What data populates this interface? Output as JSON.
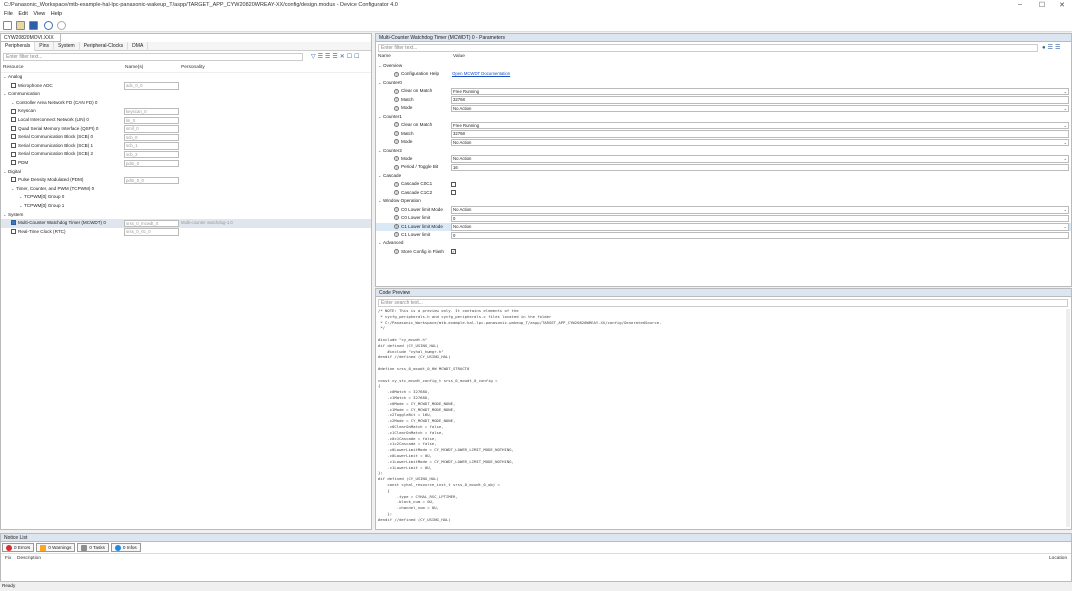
{
  "window": {
    "title": "C:/Panasonic_Workspace/mtb-example-hal-lpc-panasonic-wakeup_T/aspp/TARGET_APP_CYW20820WREAY-XX/config/design.modus - Device Configurator 4.0",
    "controls": [
      "–",
      "☐",
      "✕"
    ]
  },
  "menu": [
    "File",
    "Edit",
    "View",
    "Help"
  ],
  "left_panel": {
    "header": "CYW20820MOVI.XXX",
    "tabs": [
      "Peripherals",
      "Pins",
      "System",
      "Peripheral-Clocks",
      "DMA"
    ],
    "filter_placeholder": "Enter filter text...",
    "columns": [
      "Resource",
      "Name(s)",
      "Personality"
    ],
    "rows": [
      {
        "indent": 0,
        "type": "group",
        "label": "Analog"
      },
      {
        "indent": 1,
        "type": "item",
        "label": "Microphone ADC",
        "name": "adc_0_0",
        "checked": false
      },
      {
        "indent": 0,
        "type": "group",
        "label": "Communication"
      },
      {
        "indent": 1,
        "type": "group",
        "label": "Controller Area Network FD (CAN FD) 0"
      },
      {
        "indent": 1,
        "type": "item",
        "label": "Keyscan",
        "name": "keyscan_0",
        "checked": false
      },
      {
        "indent": 1,
        "type": "item",
        "label": "Local Interconnect Network (LIN) 0",
        "name": "lin_0",
        "checked": false
      },
      {
        "indent": 1,
        "type": "item",
        "label": "Quad Serial Memory Interface (QSPI) 0",
        "name": "smif_0",
        "checked": false
      },
      {
        "indent": 1,
        "type": "item",
        "label": "Serial Communication Block (SCB) 0",
        "name": "scb_0",
        "checked": false
      },
      {
        "indent": 1,
        "type": "item",
        "label": "Serial Communication Block (SCB) 1",
        "name": "scb_1",
        "checked": false
      },
      {
        "indent": 1,
        "type": "item",
        "label": "Serial Communication Block (SCB) 2",
        "name": "scb_2",
        "checked": false
      },
      {
        "indent": 1,
        "type": "item",
        "label": "PDM",
        "name": "pdm_0",
        "checked": false
      },
      {
        "indent": 0,
        "type": "group",
        "label": "Digital"
      },
      {
        "indent": 1,
        "type": "item",
        "label": "Pulse Density Modulated (PDM)",
        "name": "pdm_0_0",
        "checked": false
      },
      {
        "indent": 1,
        "type": "group",
        "label": "Timer, Counter, and PWM (TCPWM) 0"
      },
      {
        "indent": 2,
        "type": "group",
        "label": "TCPWM[0] Group 0"
      },
      {
        "indent": 2,
        "type": "group",
        "label": "TCPWM[0] Group 1"
      },
      {
        "indent": 0,
        "type": "group",
        "label": "System"
      },
      {
        "indent": 1,
        "type": "item",
        "label": "Multi-Counter Watchdog Timer (MCWDT) 0",
        "name": "srss_0_mcwdt_0",
        "personality": "Multi-counter watchdog-1.0",
        "checked": true,
        "selected": true
      },
      {
        "indent": 1,
        "type": "item",
        "label": "Real-Time Clock (RTC)",
        "name": "srss_0_rtc_0",
        "checked": false
      }
    ]
  },
  "params_panel": {
    "header": "Multi-Counter Watchdog Timer (MCWDT) 0 - Parameters",
    "filter_placeholder": "Enter filter text...",
    "columns": [
      "Name",
      "Value"
    ],
    "rows": [
      {
        "kind": "section",
        "label": "Overview"
      },
      {
        "kind": "param",
        "label": "Configuration Help",
        "value": "Open MCWDT Documentation",
        "link": true
      },
      {
        "kind": "section",
        "label": "Counter0"
      },
      {
        "kind": "param",
        "label": "Clear on Match",
        "value": "Free Running",
        "dropdown": true
      },
      {
        "kind": "param",
        "label": "Match",
        "value": "32768"
      },
      {
        "kind": "param",
        "label": "Mode",
        "value": "No Action",
        "dropdown": true
      },
      {
        "kind": "section",
        "label": "Counter1"
      },
      {
        "kind": "param",
        "label": "Clear on Match",
        "value": "Free Running",
        "dropdown": true
      },
      {
        "kind": "param",
        "label": "Match",
        "value": "32768"
      },
      {
        "kind": "param",
        "label": "Mode",
        "value": "No Action",
        "dropdown": true
      },
      {
        "kind": "section",
        "label": "Counter2"
      },
      {
        "kind": "param",
        "label": "Mode",
        "value": "No Action",
        "dropdown": true
      },
      {
        "kind": "param",
        "label": "Period / Toggle Bit",
        "value": "16"
      },
      {
        "kind": "section",
        "label": "Cascade"
      },
      {
        "kind": "param",
        "label": "Cascade C0C1",
        "checkbox": true
      },
      {
        "kind": "param",
        "label": "Cascade C1C2",
        "checkbox": true
      },
      {
        "kind": "section",
        "label": "Window Operation"
      },
      {
        "kind": "param",
        "label": "C0 Lower limit Mode",
        "value": "No Action",
        "dropdown": true
      },
      {
        "kind": "param",
        "label": "C0 Lower limit",
        "value": "0"
      },
      {
        "kind": "param",
        "label": "C1 Lower limit Mode",
        "value": "No Action",
        "dropdown": true,
        "highlight": true
      },
      {
        "kind": "param",
        "label": "C1 Lower limit",
        "value": "0"
      },
      {
        "kind": "section",
        "label": "Advanced"
      },
      {
        "kind": "param",
        "label": "Store Config in Flash",
        "checkbox": true,
        "checked": true
      }
    ]
  },
  "code_panel": {
    "header": "Code Preview",
    "filter_placeholder": "Enter search text...",
    "lines": [
      "/* NOTE: This is a preview only. It contains elements of the",
      " * cycfg_peripherals.h and cycfg_peripherals.c files located in the folder",
      " * C:/Panasonic_Workspace/mtb-example-hal-lpc-panasonic-wakeup_T/aspp/TARGET_APP_CYW20820WREAY-XX/config/GeneratedSource.",
      " */",
      "",
      "#include \"cy_mcwdt.h\"",
      "#if defined (CY_USING_HAL)",
      "    #include \"cyhal_hwmgr.h\"",
      "#endif //defined (CY_USING_HAL)",
      "",
      "#define srss_0_mcwdt_0_HW MCWDT_STRUCT0",
      "",
      "const cy_stc_mcwdt_config_t srss_0_mcwdt_0_config =",
      "{",
      "    .c0Match = 32768U,",
      "    .c1Match = 32768U,",
      "    .c0Mode = CY_MCWDT_MODE_NONE,",
      "    .c1Mode = CY_MCWDT_MODE_NONE,",
      "    .c2ToggleBit = 16U,",
      "    .c2Mode = CY_MCWDT_MODE_NONE,",
      "    .c0ClearOnMatch = false,",
      "    .c1ClearOnMatch = false,",
      "    .c0c1Cascade = false,",
      "    .c1c2Cascade = false,",
      "    .c0LowerLimitMode = CY_MCWDT_LOWER_LIMIT_MODE_NOTHING,",
      "    .c0LowerLimit = 0U,",
      "    .c1LowerLimitMode = CY_MCWDT_LOWER_LIMIT_MODE_NOTHING,",
      "    .c1LowerLimit = 0U,",
      "};",
      "#if defined (CY_USING_HAL)",
      "    const cyhal_resource_inst_t srss_0_mcwdt_0_obj =",
      "    {",
      "        .type = CYHAL_RSC_LPTIMER,",
      "        .block_num = 0U,",
      "        .channel_num = 0U,",
      "    };",
      "#endif //defined (CY_USING_HAL)"
    ]
  },
  "notice_list": {
    "header": "Notice List",
    "buttons": [
      {
        "label": "0 Errors",
        "color": "#d32f2f"
      },
      {
        "label": "0 Warnings",
        "color": "#f9a825"
      },
      {
        "label": "0 Tasks",
        "color": "#8d8d8d"
      },
      {
        "label": "0 Infos",
        "color": "#1e88e5"
      }
    ],
    "columns": [
      "Fix",
      "Description",
      "Location"
    ]
  },
  "status": "Ready"
}
